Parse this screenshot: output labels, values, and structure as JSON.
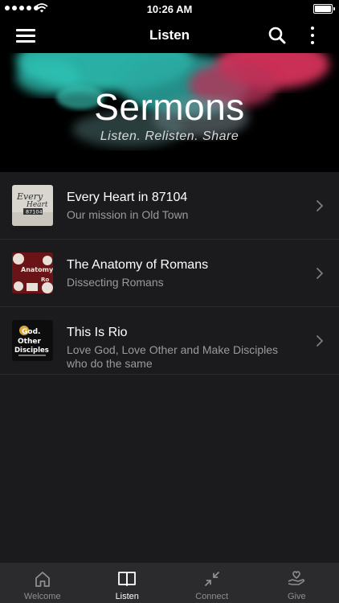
{
  "status_bar": {
    "time": "10:26 AM"
  },
  "nav": {
    "title": "Listen"
  },
  "banner": {
    "title": "Sermons",
    "subtitle": "Listen. Relisten. Share"
  },
  "series": [
    {
      "title": "Every Heart in 87104",
      "subtitle": "Our mission in Old Town",
      "thumb_text": [
        "Every",
        "Heart",
        "87104"
      ]
    },
    {
      "title": "The Anatomy of Romans",
      "subtitle": "Dissecting Romans",
      "thumb_text": [
        "Anatomy",
        "Ro"
      ]
    },
    {
      "title": "This Is Rio",
      "subtitle": "Love God, Love Other and Make Disciples who do the same",
      "thumb_text": [
        "God.",
        "Other",
        "Disciples"
      ]
    }
  ],
  "tabs": [
    {
      "label": "Welcome",
      "icon": "home-icon"
    },
    {
      "label": "Listen",
      "icon": "book-icon",
      "active": true
    },
    {
      "label": "Connect",
      "icon": "arrows-in-icon"
    },
    {
      "label": "Give",
      "icon": "heart-hand-icon"
    }
  ],
  "colors": {
    "accent_teal": "#2ec3b5",
    "accent_pink": "#e0345f",
    "background": "#1b1b1d"
  }
}
